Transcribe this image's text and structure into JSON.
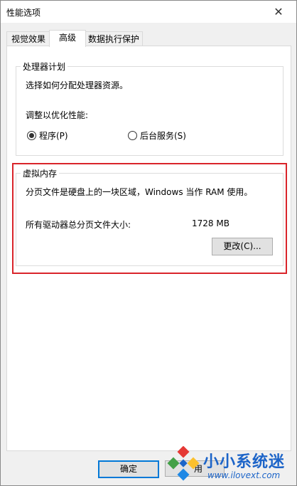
{
  "window": {
    "title": "性能选项",
    "close_glyph": "✕"
  },
  "tabs": [
    {
      "label": "视觉效果",
      "active": false
    },
    {
      "label": "高级",
      "active": true
    },
    {
      "label": "数据执行保护",
      "active": false
    }
  ],
  "processor": {
    "title": "处理器计划",
    "description": "选择如何分配处理器资源。",
    "adjust_label": "调整以优化性能:",
    "options": [
      {
        "label": "程序(P)",
        "checked": true
      },
      {
        "label": "后台服务(S)",
        "checked": false
      }
    ]
  },
  "virtual_memory": {
    "title": "虚拟内存",
    "description": "分页文件是硬盘上的一块区域，Windows 当作 RAM 使用。",
    "total_label": "所有驱动器总分页文件大小:",
    "total_value": "1728 MB",
    "change_button": "更改(C)..."
  },
  "footer": {
    "ok_button": "确定",
    "apply_button_partial": "用"
  },
  "watermark": {
    "brand": "小小系统迷",
    "url": "www.ilovext.com"
  },
  "colors": {
    "highlight": "#d9242a",
    "accent": "#0078d7",
    "watermark": "#1c64c8"
  }
}
